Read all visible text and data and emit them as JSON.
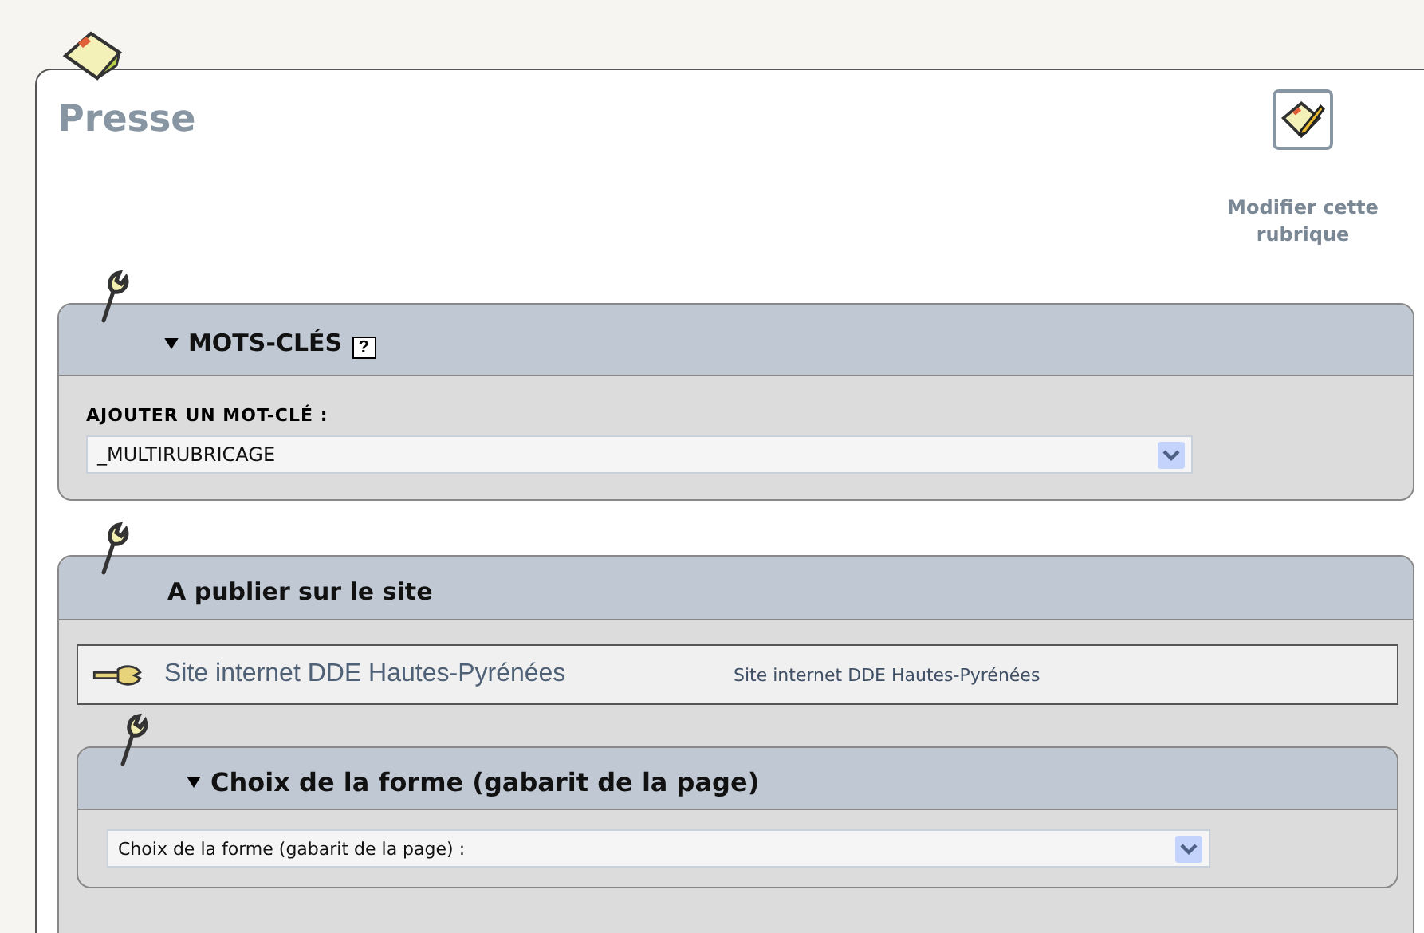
{
  "title": "Presse",
  "edit_action": {
    "label": "Modifier cette rubrique"
  },
  "keywords": {
    "title": "MOTS-CLÉS",
    "help": "?",
    "label": "AJOUTER UN MOT-CLÉ :",
    "select_value": "_MULTIRUBRICAGE"
  },
  "publish": {
    "title": "A publier sur le site",
    "site": {
      "name": "Site internet DDE Hautes-Pyrénées",
      "detail": "Site internet DDE Hautes-Pyrénées"
    }
  },
  "template": {
    "title": "Choix de la forme (gabarit de la page)",
    "select_value": "Choix de la forme (gabarit de la page) :"
  }
}
